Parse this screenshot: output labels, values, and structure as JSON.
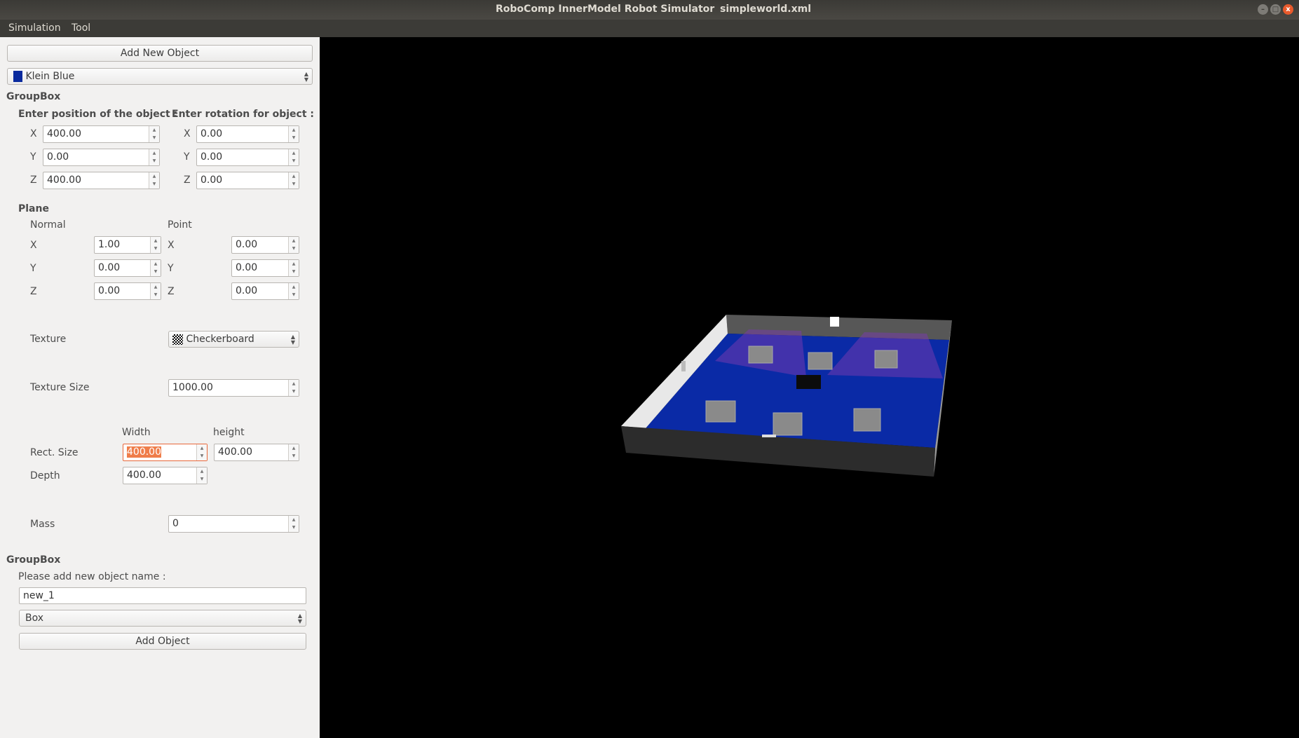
{
  "window": {
    "title": "RoboComp InnerModel Robot Simulator",
    "file": "simpleworld.xml",
    "controls": [
      "minimize",
      "maximize",
      "close"
    ]
  },
  "menu": [
    "Simulation",
    "Tool"
  ],
  "panel": {
    "add_new_object": "Add New Object",
    "color_combo": {
      "value": "Klein Blue",
      "swatch": "#0a2a9e"
    },
    "groupbox1": "GroupBox",
    "position_label": "Enter position of the object :",
    "rotation_label": "Enter rotation for object :",
    "position": [
      {
        "axis": "X",
        "value": "400.00"
      },
      {
        "axis": "Y",
        "value": "0.00"
      },
      {
        "axis": "Z",
        "value": "400.00"
      }
    ],
    "rotation": [
      {
        "axis": "X",
        "value": "0.00"
      },
      {
        "axis": "Y",
        "value": "0.00"
      },
      {
        "axis": "Z",
        "value": "0.00"
      }
    ],
    "plane": {
      "title": "Plane",
      "normal_label": "Normal",
      "point_label": "Point",
      "normal": [
        {
          "axis": "X",
          "value": "1.00"
        },
        {
          "axis": "Y",
          "value": "0.00"
        },
        {
          "axis": "Z",
          "value": "0.00"
        }
      ],
      "point": [
        {
          "axis": "X",
          "value": "0.00"
        },
        {
          "axis": "Y",
          "value": "0.00"
        },
        {
          "axis": "Z",
          "value": "0.00"
        }
      ]
    },
    "texture_label": "Texture",
    "texture_value": "Checkerboard",
    "texture_size_label": "Texture Size",
    "texture_size": "1000.00",
    "width_label": "Width",
    "height_label": "height",
    "rect_size_label": "Rect. Size",
    "rect_width": "400.00",
    "rect_height": "400.00",
    "depth_label": "Depth",
    "depth": "400.00",
    "mass_label": "Mass",
    "mass": "0",
    "groupbox2": "GroupBox",
    "name_prompt": "Please add new object name :",
    "name_value": "new_1",
    "type_value": "Box",
    "add_object": "Add Object"
  }
}
